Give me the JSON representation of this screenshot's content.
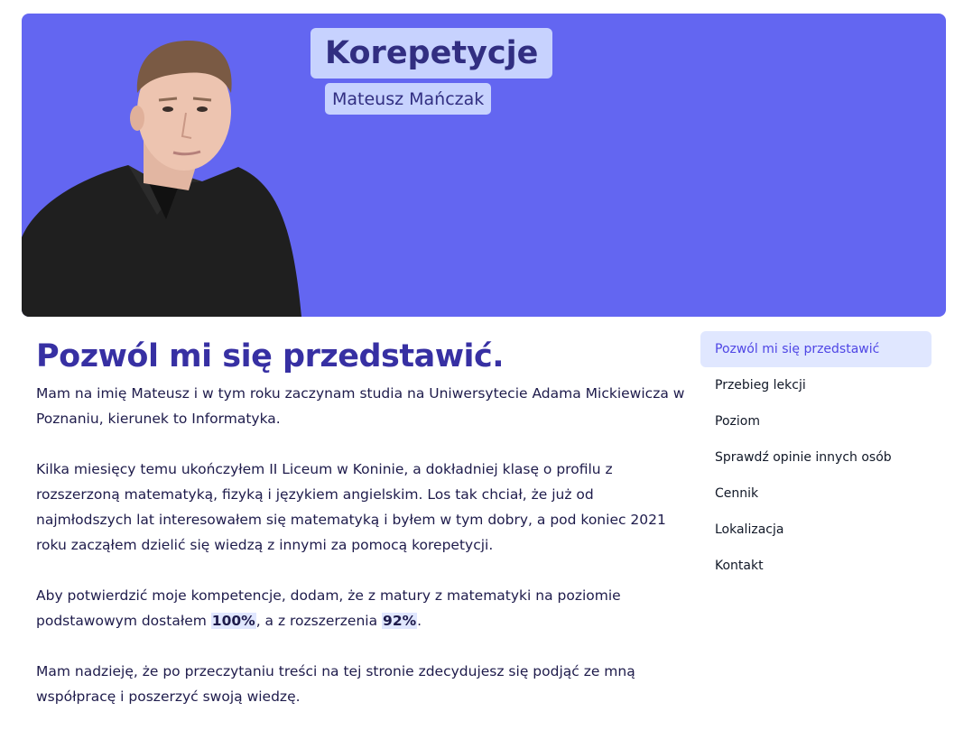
{
  "header": {
    "title": "Korepetycje",
    "subtitle": "Mateusz Mańczak",
    "portrait_icon": "person-portrait"
  },
  "main": {
    "heading": "Pozwól mi się przedstawić.",
    "p1": "Mam na imię Mateusz i w tym roku zaczynam studia na Uniwersytecie Adama Mickiewicza w Poznaniu, kierunek to Informatyka.",
    "p2": "Kilka miesięcy temu ukończyłem II Liceum w Koninie, a dokładniej klasę o profilu z rozszerzoną matematyką, fizyką i językiem angielskim. Los tak chciał, że już od najmłodszych lat interesowałem się matematyką i byłem w tym dobry, a pod koniec 2021 roku zacząłem dzielić się wiedzą z innymi za pomocą korepetycji.",
    "p3_a": "Aby potwierdzić moje kompetencje, dodam, że z matury z matematyki na poziomie podstawowym dostałem ",
    "p3_score_basic": "100%",
    "p3_b": ", a z rozszerzenia ",
    "p3_score_ext": "92%",
    "p3_c": ".",
    "p4": "Mam nadzieję, że po przeczytaniu treści na tej stronie zdecydujesz się podjąć ze mną współpracę i poszerzyć swoją wiedzę."
  },
  "nav": {
    "items": [
      {
        "label": "Pozwól mi się przedstawić",
        "active": true
      },
      {
        "label": "Przebieg lekcji"
      },
      {
        "label": "Poziom"
      },
      {
        "label": "Sprawdź opinie innych osób"
      },
      {
        "label": "Cennik"
      },
      {
        "label": "Lokalizacja"
      },
      {
        "label": "Kontakt"
      }
    ]
  },
  "colors": {
    "hero_bg": "#6366f1",
    "title_box": "#c7d2fe",
    "heading": "#3730a3",
    "nav_active_bg": "#e0e7ff",
    "nav_active_text": "#4f46e5"
  }
}
